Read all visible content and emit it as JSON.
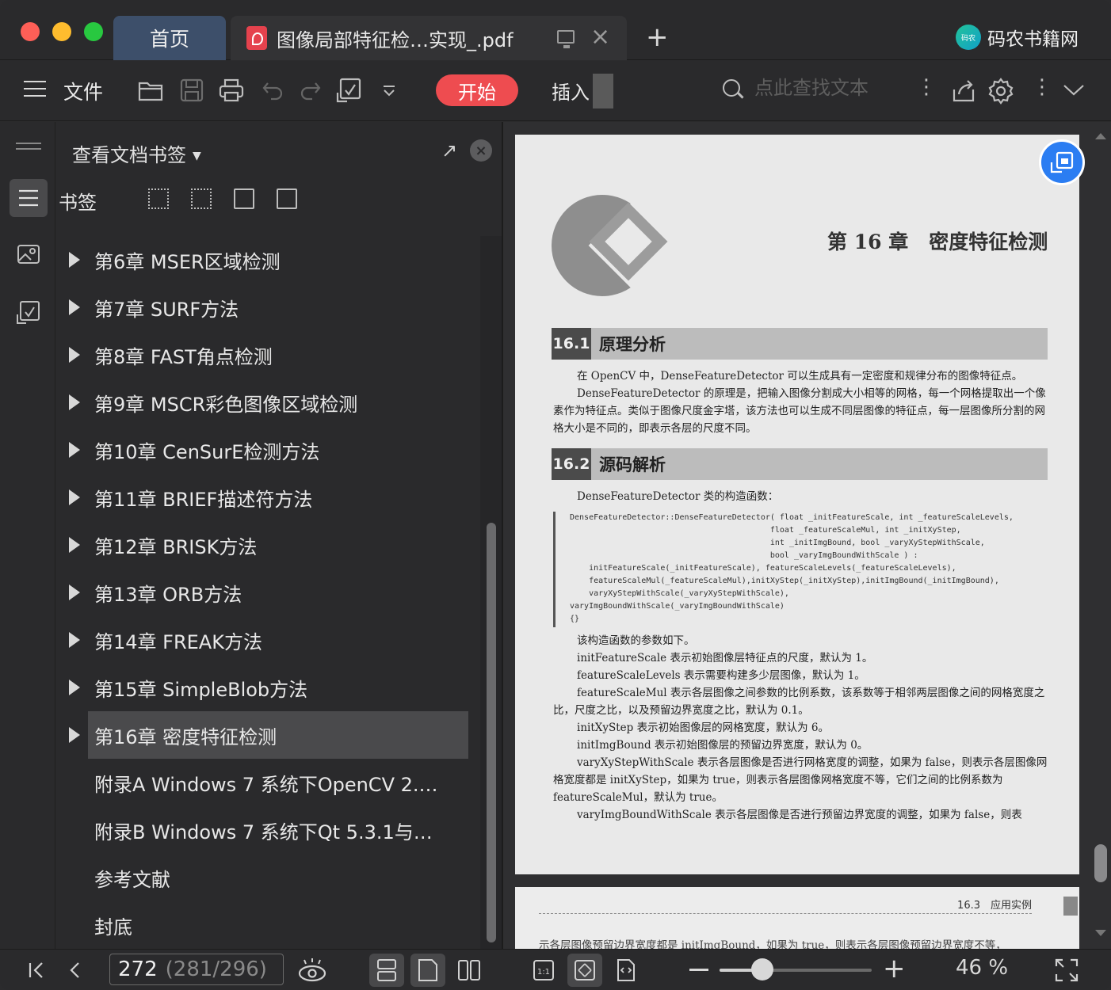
{
  "tabs": {
    "home_label": "首页",
    "doc_title": "图像局部特征检…实现_.pdf"
  },
  "brand": {
    "logo_text": "码农",
    "name": "码农书籍网"
  },
  "toolbar": {
    "file_label": "文件",
    "start_label": "开始",
    "insert_label": "插入",
    "search_placeholder": "点此查找文本",
    "accent_color": "#ee4c50"
  },
  "panel": {
    "title": "查看文档书签",
    "bookmarks_label": "书签",
    "items": [
      {
        "label": "第6章 MSER区域检测",
        "expandable": true
      },
      {
        "label": "第7章 SURF方法",
        "expandable": true
      },
      {
        "label": "第8章 FAST角点检测",
        "expandable": true
      },
      {
        "label": "第9章 MSCR彩色图像区域检测",
        "expandable": true
      },
      {
        "label": "第10章 CenSurE检测方法",
        "expandable": true
      },
      {
        "label": "第11章 BRIEF描述符方法",
        "expandable": true
      },
      {
        "label": "第12章 BRISK方法",
        "expandable": true
      },
      {
        "label": "第13章 ORB方法",
        "expandable": true
      },
      {
        "label": "第14章 FREAK方法",
        "expandable": true
      },
      {
        "label": "第15章 SimpleBlob方法",
        "expandable": true
      },
      {
        "label": "第16章 密度特征检测",
        "expandable": true,
        "active": true
      },
      {
        "label": "附录A Windows 7 系统下OpenCV 2.…",
        "expandable": false
      },
      {
        "label": "附录B Windows 7 系统下Qt 5.3.1与…",
        "expandable": false
      },
      {
        "label": "参考文献",
        "expandable": false
      },
      {
        "label": "封底",
        "expandable": false
      }
    ]
  },
  "document": {
    "chapter_number": "第 16 章",
    "chapter_title": "密度特征检测",
    "sec1_num": "16.1",
    "sec1_title": "原理分析",
    "sec1_p1": "在 OpenCV 中，DenseFeatureDetector 可以生成具有一定密度和规律分布的图像特征点。",
    "sec1_p2": "DenseFeatureDetector 的原理是，把输入图像分割成大小相等的网格，每一个网格提取出一个像素作为特征点。类似于图像尺度金字塔，该方法也可以生成不同层图像的特征点，每一层图像所分割的网格大小是不同的，即表示各层的尺度不同。",
    "sec2_num": "16.2",
    "sec2_title": "源码解析",
    "sec2_intro": "DenseFeatureDetector 类的构造函数：",
    "code": "DenseFeatureDetector::DenseFeatureDetector( float _initFeatureScale, int _featureScaleLevels,\n                                          float _featureScaleMul, int _initXyStep,\n                                          int _initImgBound, bool _varyXyStepWithScale,\n                                          bool _varyImgBoundWithScale ) :\n    initFeatureScale(_initFeatureScale), featureScaleLevels(_featureScaleLevels),\n    featureScaleMul(_featureScaleMul),initXyStep(_initXyStep),initImgBound(_initImgBound),\n    varyXyStepWithScale(_varyXyStepWithScale),\nvaryImgBoundWithScale(_varyImgBoundWithScale)\n{}",
    "params_intro": "该构造函数的参数如下。",
    "params": [
      "initFeatureScale 表示初始图像层特征点的尺度，默认为 1。",
      "featureScaleLevels 表示需要构建多少层图像，默认为 1。",
      "featureScaleMul 表示各层图像之间参数的比例系数，该系数等于相邻两层图像之间的网格宽度之比，尺度之比，以及预留边界宽度之比，默认为 0.1。",
      "initXyStep 表示初始图像层的网格宽度，默认为 6。",
      "initImgBound 表示初始图像层的预留边界宽度，默认为 0。",
      "varyXyStepWithScale 表示各层图像是否进行网格宽度的调整，如果为 false，则表示各层图像网格宽度都是 initXyStep，如果为 true，则表示各层图像网格宽度不等，它们之间的比例系数为 featureScaleMul，默认为 true。",
      "varyImgBoundWithScale 表示各层图像是否进行预留边界宽度的调整，如果为 false，则表"
    ],
    "next_page_header": "16.3　应用实例",
    "next_page_line": "示各层图像预留边界宽度都是 initImgBound，如果为 true，则表示各层图像预留边界宽度不等，"
  },
  "status": {
    "page_current": "272",
    "page_total": "(281/296)",
    "zoom_label": "46 %",
    "zoom_fraction": 0.28
  }
}
